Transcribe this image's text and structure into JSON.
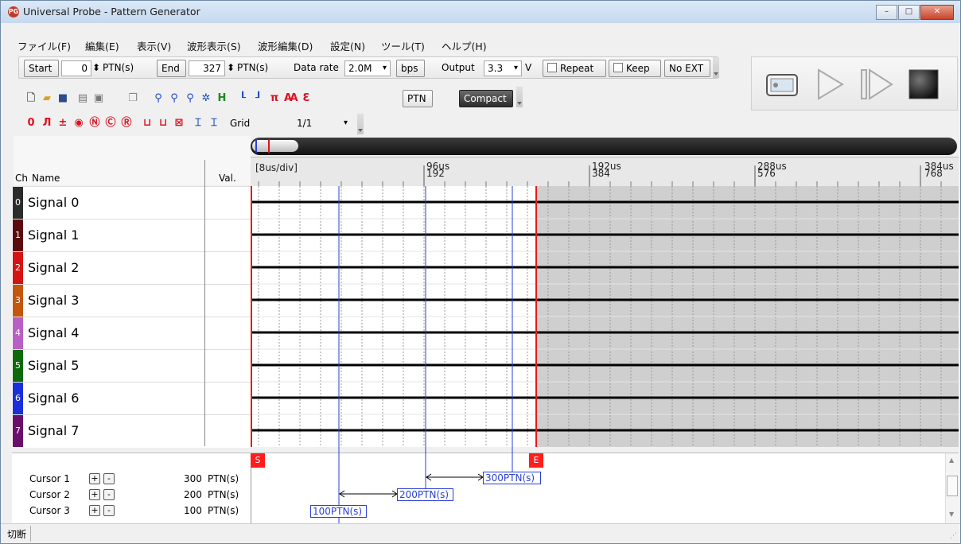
{
  "window": {
    "title": "Universal Probe - Pattern Generator",
    "app_icon_text": "PG"
  },
  "menu": [
    "ファイル(F)",
    "編集(E)",
    "表示(V)",
    "波形表示(S)",
    "波形編集(D)",
    "設定(N)",
    "ツール(T)",
    "ヘルプ(H)"
  ],
  "toolbar": {
    "start_label": "Start",
    "start_value": "0",
    "start_unit": "PTN(s)",
    "end_label": "End",
    "end_value": "327",
    "end_unit": "PTN(s)",
    "datarate_label": "Data rate",
    "datarate_value": "2.0M",
    "datarate_unit": "bps",
    "output_label": "Output",
    "output_value": "3.3",
    "output_unit": "V",
    "repeat_label": "Repeat",
    "keep_label": "Keep",
    "noext_label": "No EXT",
    "ptn_label": "PTN",
    "compact_label": "Compact",
    "grid_label": "Grid",
    "grid_value": "1/1"
  },
  "channels": {
    "header_ch": "Ch",
    "header_name": "Name",
    "header_val": "Val.",
    "items": [
      {
        "num": "0",
        "name": "Signal 0",
        "color": "#2b2b2b"
      },
      {
        "num": "1",
        "name": "Signal 1",
        "color": "#5a0c0c"
      },
      {
        "num": "2",
        "name": "Signal 2",
        "color": "#d41414"
      },
      {
        "num": "3",
        "name": "Signal 3",
        "color": "#c2570d"
      },
      {
        "num": "4",
        "name": "Signal 4",
        "color": "#b85fc4"
      },
      {
        "num": "5",
        "name": "Signal 5",
        "color": "#0c6a0c"
      },
      {
        "num": "6",
        "name": "Signal 6",
        "color": "#1a2fd9"
      },
      {
        "num": "7",
        "name": "Signal 7",
        "color": "#6a0e6a"
      }
    ]
  },
  "timeline": {
    "scale": "[8us/div]",
    "ticks": [
      {
        "time": "96us",
        "ptn": "192"
      },
      {
        "time": "192us",
        "ptn": "384"
      },
      {
        "time": "288us",
        "ptn": "576"
      },
      {
        "time": "384us",
        "ptn": "768"
      }
    ]
  },
  "markers": {
    "start": "S",
    "end": "E"
  },
  "cursors": [
    {
      "label": "Cursor 1",
      "value": "300",
      "unit": "PTN(s)",
      "box": "300PTN(s)"
    },
    {
      "label": "Cursor 2",
      "value": "200",
      "unit": "PTN(s)",
      "box": "200PTN(s)"
    },
    {
      "label": "Cursor 3",
      "value": "100",
      "unit": "PTN(s)",
      "box": "100PTN(s)"
    }
  ],
  "status": {
    "text": "切断"
  }
}
